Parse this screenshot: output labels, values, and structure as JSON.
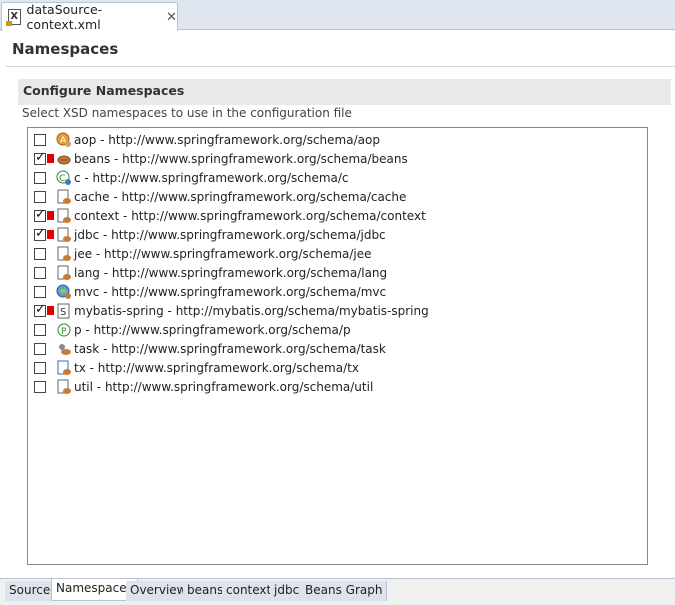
{
  "editor_tab": {
    "title": "dataSource-context.xml"
  },
  "page_title": "Namespaces",
  "section": {
    "title": "Configure Namespaces",
    "description": "Select XSD namespaces to use in the configuration file"
  },
  "namespaces": [
    {
      "label": "aop - http://www.springframework.org/schema/aop",
      "checked": false,
      "marked": false,
      "icon": "aop-icon"
    },
    {
      "label": "beans - http://www.springframework.org/schema/beans",
      "checked": true,
      "marked": true,
      "icon": "beans-icon"
    },
    {
      "label": "c - http://www.springframework.org/schema/c",
      "checked": false,
      "marked": false,
      "icon": "c-namespace-icon"
    },
    {
      "label": "cache - http://www.springframework.org/schema/cache",
      "checked": false,
      "marked": false,
      "icon": "cache-icon"
    },
    {
      "label": "context - http://www.springframework.org/schema/context",
      "checked": true,
      "marked": true,
      "icon": "context-icon"
    },
    {
      "label": "jdbc - http://www.springframework.org/schema/jdbc",
      "checked": true,
      "marked": true,
      "icon": "jdbc-icon"
    },
    {
      "label": "jee - http://www.springframework.org/schema/jee",
      "checked": false,
      "marked": false,
      "icon": "jee-icon"
    },
    {
      "label": "lang - http://www.springframework.org/schema/lang",
      "checked": false,
      "marked": false,
      "icon": "lang-icon"
    },
    {
      "label": "mvc - http://www.springframework.org/schema/mvc",
      "checked": false,
      "marked": false,
      "icon": "mvc-icon"
    },
    {
      "label": "mybatis-spring - http://mybatis.org/schema/mybatis-spring",
      "checked": true,
      "marked": true,
      "icon": "mybatis-icon"
    },
    {
      "label": "p - http://www.springframework.org/schema/p",
      "checked": false,
      "marked": false,
      "icon": "p-namespace-icon"
    },
    {
      "label": "task - http://www.springframework.org/schema/task",
      "checked": false,
      "marked": false,
      "icon": "task-icon"
    },
    {
      "label": "tx - http://www.springframework.org/schema/tx",
      "checked": false,
      "marked": false,
      "icon": "tx-icon"
    },
    {
      "label": "util - http://www.springframework.org/schema/util",
      "checked": false,
      "marked": false,
      "icon": "util-icon"
    }
  ],
  "bottom_tabs": [
    {
      "label": "Source",
      "active": false
    },
    {
      "label": "Namespaces",
      "active": true
    },
    {
      "label": "Overview",
      "active": false
    },
    {
      "label": "beans",
      "active": false
    },
    {
      "label": "context",
      "active": false
    },
    {
      "label": "jdbc",
      "active": false
    },
    {
      "label": "Beans Graph",
      "active": false
    }
  ],
  "colors": {
    "mark_red": "#e00000",
    "section_bg": "#e9e9e9",
    "tab_strip_bg": "#dfe6f0"
  }
}
